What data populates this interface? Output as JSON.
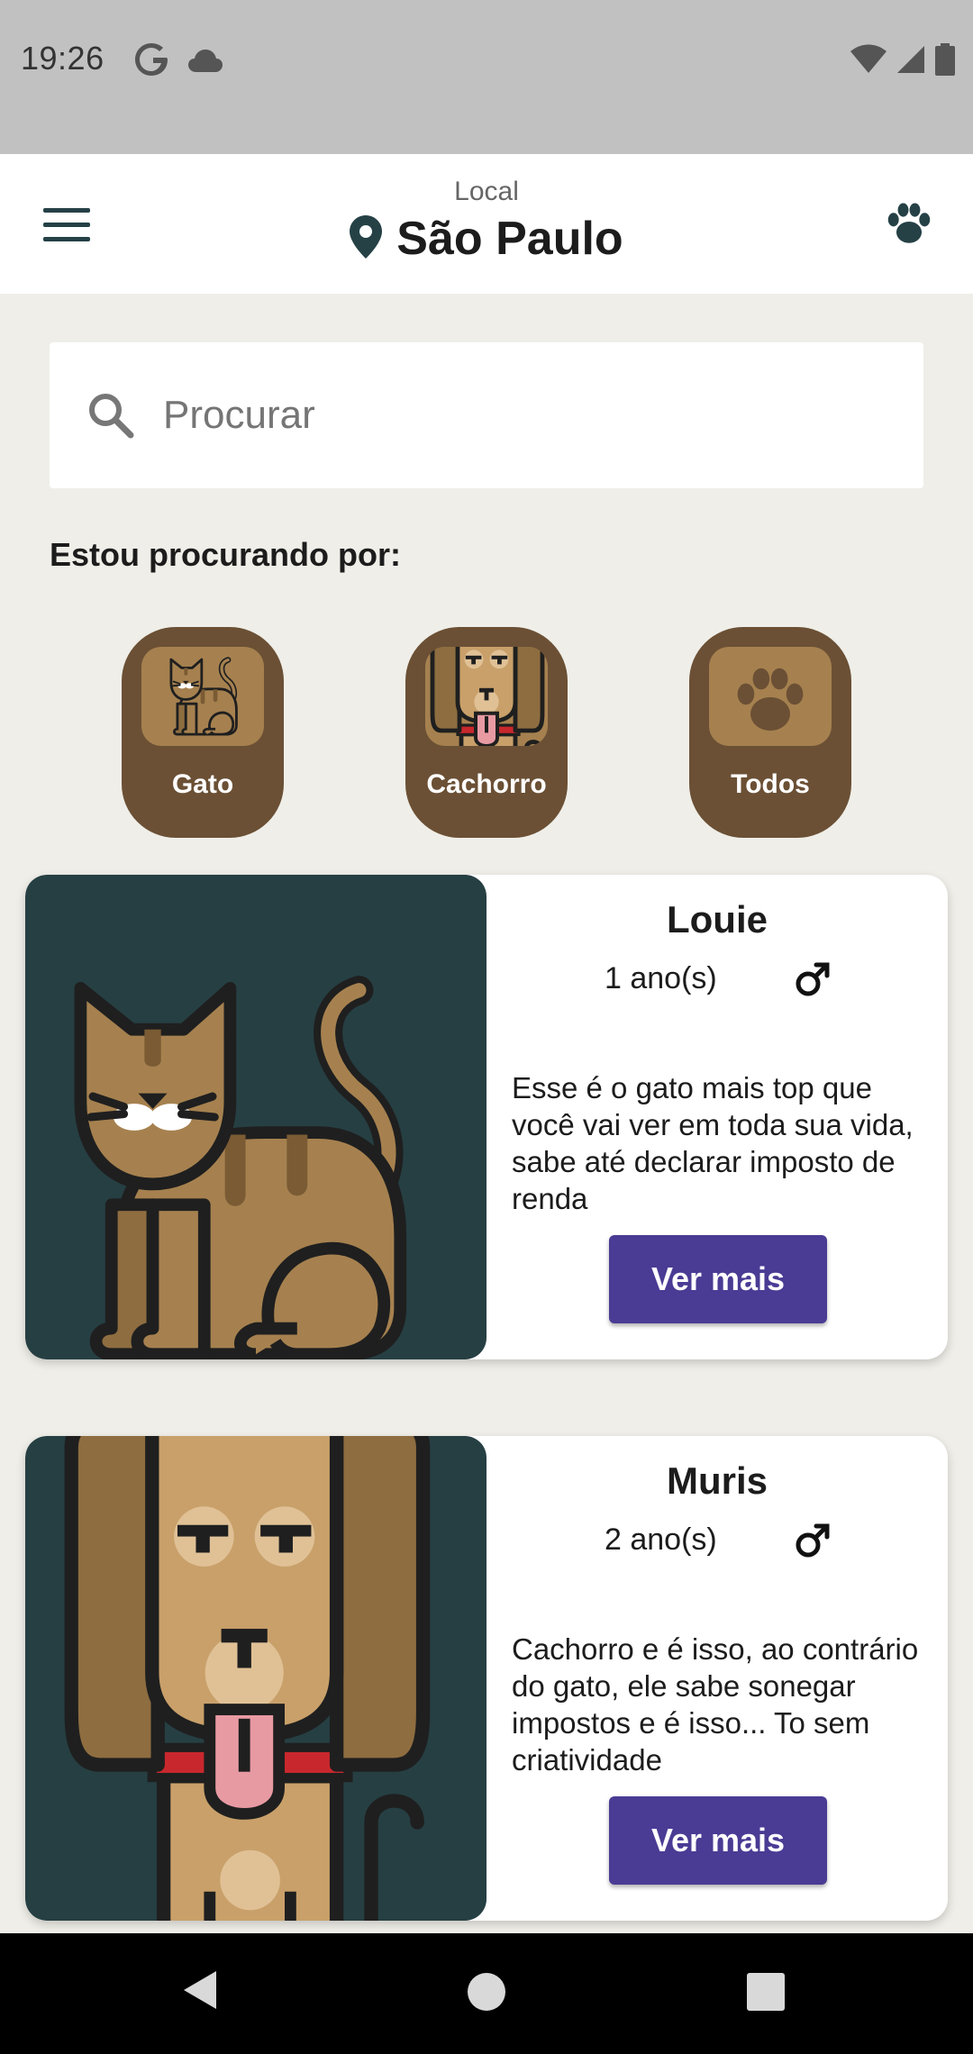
{
  "status_bar": {
    "time": "19:26",
    "icons": [
      "google-icon",
      "cloud-icon",
      "wifi-icon",
      "signal-icon",
      "battery-icon"
    ]
  },
  "app_bar": {
    "location_label": "Local",
    "location_name": "São Paulo",
    "icons": [
      "menu-icon",
      "location-pin-icon",
      "paw-icon"
    ]
  },
  "search": {
    "placeholder": "Procurar"
  },
  "filter": {
    "title": "Estou procurando por:",
    "options": [
      {
        "label": "Gato",
        "icon": "cat-icon"
      },
      {
        "label": "Cachorro",
        "icon": "dog-icon"
      },
      {
        "label": "Todos",
        "icon": "paw-icon"
      }
    ]
  },
  "pets": [
    {
      "name": "Louie",
      "age": "1 ano(s)",
      "gender": "male",
      "description": "Esse é o gato mais top que você vai ver em toda sua vida, sabe até declarar imposto de renda",
      "button": "Ver mais"
    },
    {
      "name": "Muris",
      "age": "2 ano(s)",
      "gender": "male",
      "description": "Cachorro e é isso, ao contrário do gato, ele sabe sonegar impostos e é isso... To sem criatividade",
      "button": "Ver mais"
    }
  ],
  "colors": {
    "accent": "#4a3b94",
    "filter_bg": "#6b5035",
    "card_image_bg": "#263f43",
    "dark_teal": "#254146",
    "page_bg": "#efeee8"
  }
}
